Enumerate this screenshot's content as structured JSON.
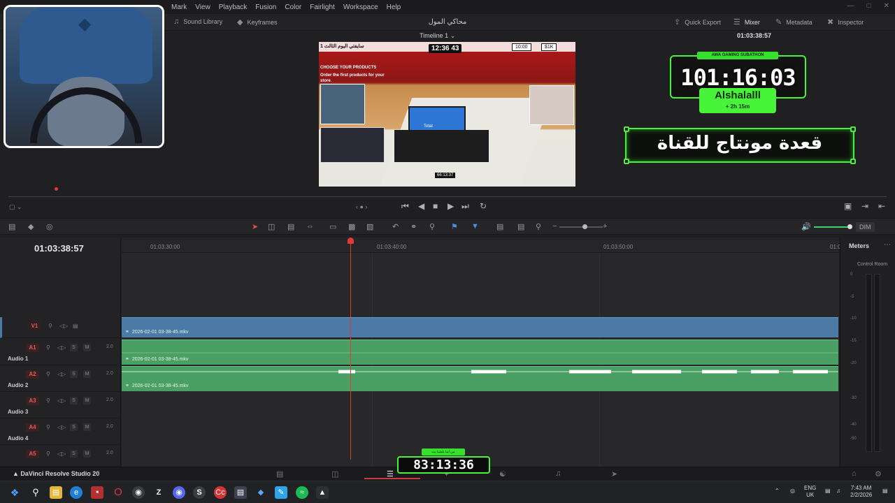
{
  "menu": [
    "Mark",
    "View",
    "Playback",
    "Fusion",
    "Color",
    "Fairlight",
    "Workspace",
    "Help"
  ],
  "toolbar": {
    "sound_library": "Sound Library",
    "keyframes": "Keyframes",
    "project_title": "محاكي المول",
    "quick_export": "Quick Export",
    "mixer": "Mixer",
    "metadata": "Metadata",
    "inspector": "Inspector"
  },
  "viewer": {
    "timeline_name": "Timeline 1",
    "timecode": "01:03:38:57"
  },
  "game": {
    "top_left": "1",
    "top_text": "سايفتي اليوم الثالث",
    "clock": "12:36 43",
    "money": "10:00",
    "cash": "$1K",
    "products_heading": "CHOOSE YOUR PRODUCTS",
    "products_text": "Order the first products for your store.",
    "total": "Total",
    "bottom": "66:13:37"
  },
  "overlay": {
    "subathon_label": "AWA GAMING SUBATHON",
    "subathon_timer": "101:16:03",
    "streamer_name": "Alshalalll",
    "extra_time": "+ 2h 15m",
    "banner": "قعدة مونتاج للقناة",
    "live_label": "من لما بلشنا بث",
    "live_timer": "83:13:36"
  },
  "timeline": {
    "timecode": "01:03:38:57",
    "ruler": [
      "01:03:30:00",
      "01:03:40:00",
      "01:03:50:00",
      "01:0"
    ],
    "clip_name": "2026-02-01 03-38-45.mkv",
    "tracks": [
      {
        "id": "V1",
        "name": "",
        "value": ""
      },
      {
        "id": "A1",
        "name": "Audio 1",
        "value": "2.0"
      },
      {
        "id": "A2",
        "name": "Audio 2",
        "value": "2.0"
      },
      {
        "id": "A3",
        "name": "Audio 3",
        "value": "2.0"
      },
      {
        "id": "A4",
        "name": "Audio 4",
        "value": "2.0"
      },
      {
        "id": "A5",
        "name": "",
        "value": "2.0"
      }
    ],
    "dim": "DIM"
  },
  "meters": {
    "title": "Meters",
    "control_room": "Control Room",
    "ticks": [
      "0",
      "-5",
      "-10",
      "-15",
      "-20",
      "-30",
      "-40",
      "-50"
    ]
  },
  "pagebar": {
    "app_name": "DaVinci Resolve Studio 20"
  },
  "taskbar": {
    "language_top": "ENG",
    "language_bottom": "UK",
    "time": "7:43 AM",
    "date": "2/2/2026"
  },
  "colors": {
    "accent_green": "#47f43a",
    "playhead_red": "#e03a3a",
    "video_clip": "#4a7aa5",
    "audio_clip": "#4aa064"
  }
}
